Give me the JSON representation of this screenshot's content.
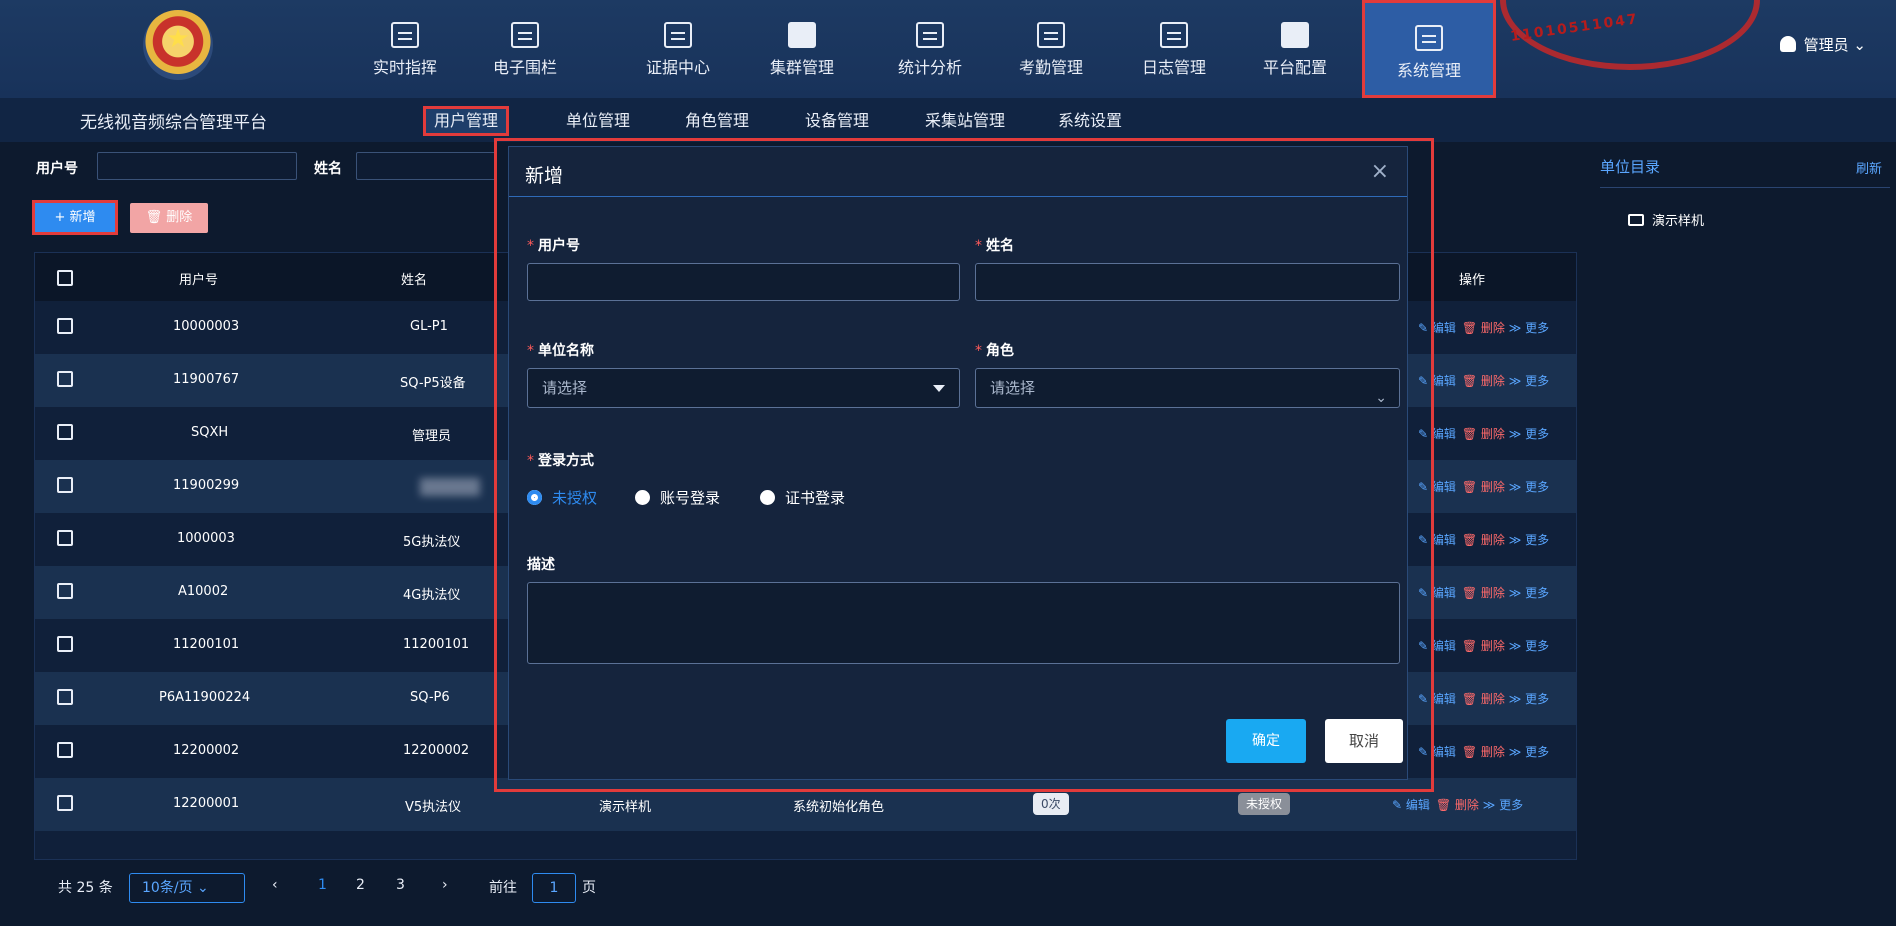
{
  "topnav": {
    "items": [
      {
        "label": "实时指挥",
        "icon": "monitor-icon"
      },
      {
        "label": "电子围栏",
        "icon": "fence-icon"
      },
      {
        "label": "证据中心",
        "icon": "evidence-icon"
      },
      {
        "label": "集群管理",
        "icon": "cluster-icon"
      },
      {
        "label": "统计分析",
        "icon": "chart-icon"
      },
      {
        "label": "考勤管理",
        "icon": "calendar-icon"
      },
      {
        "label": "日志管理",
        "icon": "log-icon"
      },
      {
        "label": "平台配置",
        "icon": "config-icon"
      },
      {
        "label": "系统管理",
        "icon": "system-icon"
      }
    ],
    "user": "管理员",
    "seal_text": "11010511047"
  },
  "subnav": {
    "brand": "无线视音频综合管理平台",
    "tabs": [
      "用户管理",
      "单位管理",
      "角色管理",
      "设备管理",
      "采集站管理",
      "系统设置"
    ]
  },
  "filter": {
    "user_no_label": "用户号",
    "name_label": "姓名",
    "add_label": "+ 新增",
    "delete_label": "🗑 删除"
  },
  "table": {
    "headers": {
      "user_no": "用户号",
      "name": "姓名",
      "ops": "操作"
    },
    "ops": {
      "edit": "✎ 编辑",
      "delete": "🗑 删除",
      "more": "≫ 更多"
    },
    "rows": [
      {
        "user_no": "10000003",
        "name": "GL-P1"
      },
      {
        "user_no": "11900767",
        "name": "SQ-P5设备"
      },
      {
        "user_no": "SQXH",
        "name": "管理员"
      },
      {
        "user_no": "11900299",
        "name": ""
      },
      {
        "user_no": "1000003",
        "name": "5G执法仪"
      },
      {
        "user_no": "A10002",
        "name": "4G执法仪"
      },
      {
        "user_no": "11200101",
        "name": "11200101"
      },
      {
        "user_no": "P6A11900224",
        "name": "SQ-P6"
      },
      {
        "user_no": "12200002",
        "name": "12200002"
      },
      {
        "user_no": "12200001",
        "name": "V5执法仪",
        "unit": "演示样机",
        "role": "系统初始化角色",
        "count": "0次",
        "auth": "未授权"
      }
    ]
  },
  "pager": {
    "total": "共 25 条",
    "page_size": "10条/页",
    "pages": [
      "1",
      "2",
      "3"
    ],
    "goto_label": "前往",
    "goto_value": "1",
    "page_suffix": "页"
  },
  "right_panel": {
    "title": "单位目录",
    "refresh": "刷新",
    "item": "演示样机"
  },
  "modal": {
    "title": "新增",
    "user_no_label": "用户号",
    "name_label": "姓名",
    "unit_label": "单位名称",
    "unit_placeholder": "请选择",
    "role_label": "角色",
    "role_placeholder": "请选择",
    "login_label": "登录方式",
    "login_options": [
      "未授权",
      "账号登录",
      "证书登录"
    ],
    "desc_label": "描述",
    "ok": "确定",
    "cancel": "取消"
  },
  "colors": {
    "accent": "#2e8bf0",
    "highlight": "#e23b3b",
    "background": "#0d1a2e"
  }
}
